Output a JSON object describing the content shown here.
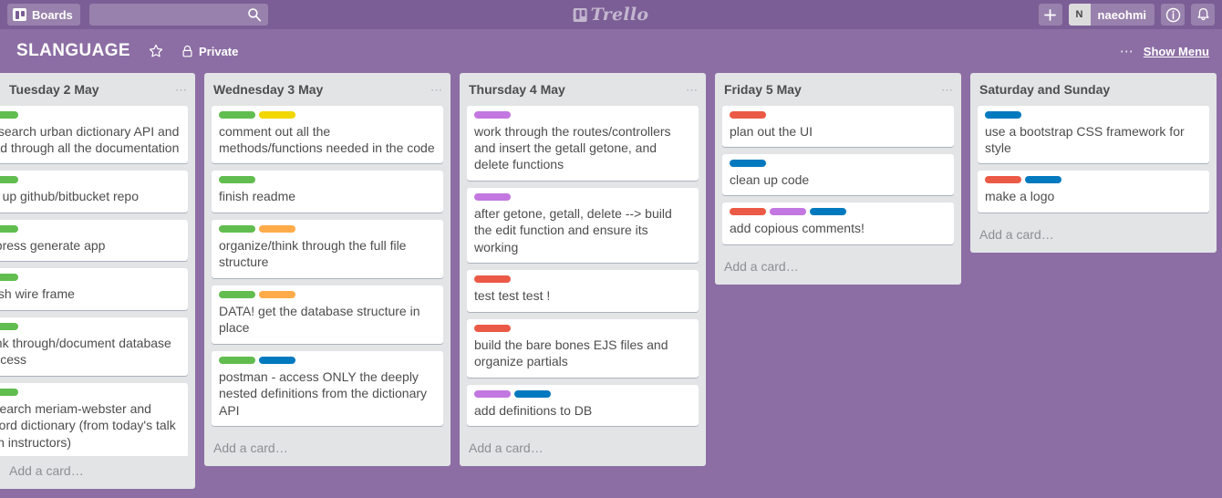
{
  "colors": {
    "nav_bar": "#7b5e95",
    "board_bg": "#8c6ea4",
    "list_bg": "#e2e4e6",
    "card_bg": "#ffffff",
    "label_green": "#61bd4f",
    "label_yellow": "#f2d600",
    "label_orange": "#ffab4a",
    "label_red": "#eb5a46",
    "label_purple": "#c377e0",
    "label_blue": "#0079bf"
  },
  "top_nav": {
    "boards_label": "Boards",
    "search_value": "",
    "search_placeholder": "",
    "logo_text": "Trello",
    "add_label": "+",
    "avatar_initial": "N",
    "member_name": "naeohmi",
    "info_label": "i",
    "notifications_label": "bell"
  },
  "board_header": {
    "title": "SLANGUAGE",
    "star_label": "",
    "privacy_label": "Private",
    "menu_dots": "⋯",
    "show_menu_label": "Show Menu"
  },
  "board": {
    "add_card_label": "Add a card…",
    "list_menu_dots": "⋯",
    "lists": [
      {
        "title": "Tuesday 2 May",
        "has_menu": true,
        "add_card_label": "Add a card…",
        "cards": [
          {
            "text": "Research urban dictionary API and read through all the documentation",
            "labels": [
              "#61bd4f"
            ]
          },
          {
            "text": "set up github/bitbucket repo",
            "labels": [
              "#61bd4f"
            ]
          },
          {
            "text": "express generate app",
            "labels": [
              "#61bd4f"
            ]
          },
          {
            "text": "finish wire frame",
            "labels": [
              "#61bd4f"
            ]
          },
          {
            "text": "think through/document database process",
            "labels": [
              "#61bd4f"
            ]
          },
          {
            "text": "research meriam-webster and oxford dictionary (from today's talk with instructors)",
            "labels": [
              "#61bd4f"
            ]
          }
        ]
      },
      {
        "title": "Wednesday 3 May",
        "has_menu": true,
        "add_card_label": "Add a card…",
        "cards": [
          {
            "text": "comment out all the methods/functions needed in the code",
            "labels": [
              "#61bd4f",
              "#f2d600"
            ]
          },
          {
            "text": "finish readme",
            "labels": [
              "#61bd4f"
            ]
          },
          {
            "text": "organize/think through the full file structure",
            "labels": [
              "#61bd4f",
              "#ffab4a"
            ]
          },
          {
            "text": "DATA! get the database structure in place",
            "labels": [
              "#61bd4f",
              "#ffab4a"
            ]
          },
          {
            "text": "postman - access ONLY the deeply nested definitions from the dictionary API",
            "labels": [
              "#61bd4f",
              "#0079bf"
            ]
          }
        ]
      },
      {
        "title": "Thursday 4 May",
        "has_menu": true,
        "add_card_label": "Add a card…",
        "cards": [
          {
            "text": "work through the routes/controllers and insert the getall getone, and delete functions",
            "labels": [
              "#c377e0"
            ]
          },
          {
            "text": "after getone, getall, delete --> build the edit function and ensure its working",
            "labels": [
              "#c377e0"
            ]
          },
          {
            "text": "test test test !",
            "labels": [
              "#eb5a46"
            ]
          },
          {
            "text": "build the bare bones EJS files and organize partials",
            "labels": [
              "#eb5a46"
            ]
          },
          {
            "text": "add definitions to DB",
            "labels": [
              "#c377e0",
              "#0079bf"
            ]
          }
        ]
      },
      {
        "title": "Friday 5 May",
        "has_menu": true,
        "add_card_label": "Add a card…",
        "cards": [
          {
            "text": "plan out the UI",
            "labels": [
              "#eb5a46"
            ]
          },
          {
            "text": "clean up code",
            "labels": [
              "#0079bf"
            ]
          },
          {
            "text": "add copious comments!",
            "labels": [
              "#eb5a46",
              "#c377e0",
              "#0079bf"
            ]
          }
        ]
      },
      {
        "title": "Saturday and Sunday",
        "has_menu": false,
        "add_card_label": "Add a card…",
        "cards": [
          {
            "text": "use a bootstrap CSS framework for style",
            "labels": [
              "#0079bf"
            ]
          },
          {
            "text": "make a logo",
            "labels": [
              "#eb5a46",
              "#0079bf"
            ]
          }
        ]
      }
    ]
  }
}
